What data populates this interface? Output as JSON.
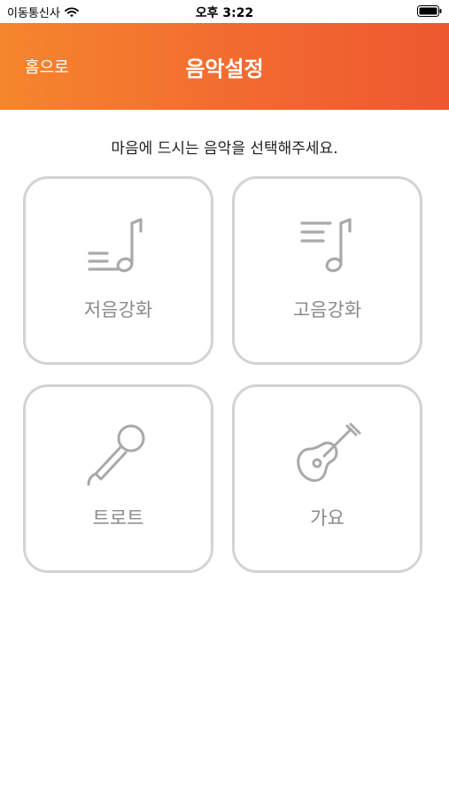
{
  "status_bar": {
    "carrier": "이동통신사",
    "time": "오후 3:22",
    "wifi_icon": "wifi-icon",
    "battery_icon": "battery-icon"
  },
  "header": {
    "home_label": "홈으로",
    "title": "음악설정",
    "gradient": [
      "#f5862d",
      "#ee5830"
    ]
  },
  "instruction": "마음에 드시는 음악을 선택해주세요.",
  "options": [
    {
      "label": "저음강화",
      "icon": "bass-note-icon"
    },
    {
      "label": "고음강화",
      "icon": "treble-note-icon"
    },
    {
      "label": "트로트",
      "icon": "microphone-icon"
    },
    {
      "label": "가요",
      "icon": "guitar-icon"
    }
  ],
  "colors": {
    "tile_border": "#d3d3d3",
    "tile_icon": "#a9a9a9",
    "tile_label": "#8a8a8a"
  }
}
